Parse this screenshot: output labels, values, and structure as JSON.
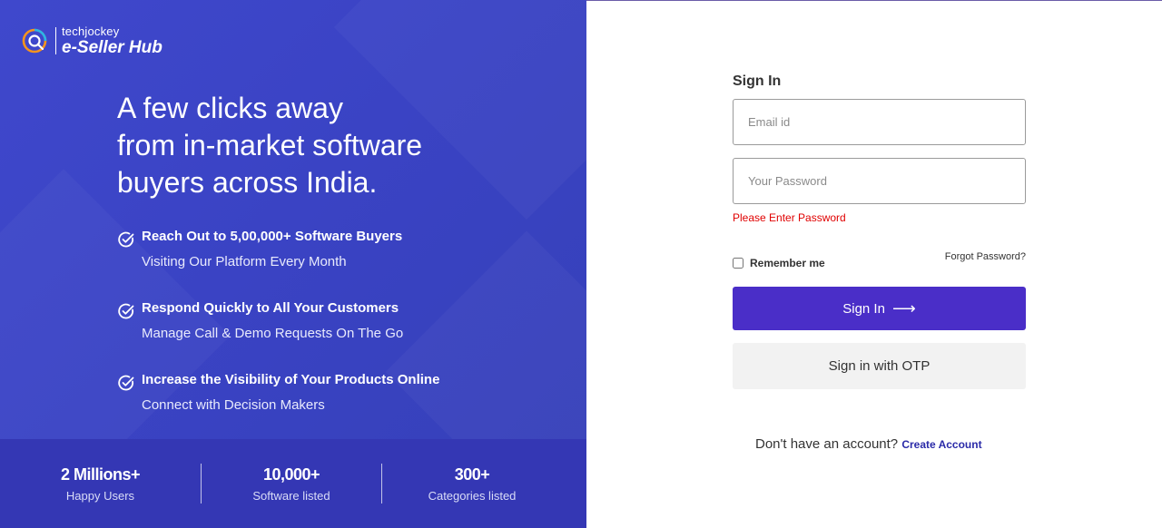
{
  "brand": {
    "small": "techjockey",
    "big": "e-Seller Hub",
    "accent_colors": [
      "#f7941d",
      "#29b5e8"
    ]
  },
  "hero": {
    "headline_lines": [
      "A few clicks away",
      "from in-market software",
      "buyers across India."
    ]
  },
  "features": [
    {
      "icon": "check-circle-icon",
      "title": "Reach Out to 5,00,000+ Software Buyers",
      "subtitle": "Visiting Our Platform Every Month"
    },
    {
      "icon": "check-circle-icon",
      "title": "Respond Quickly to All Your Customers",
      "subtitle": "Manage Call & Demo Requests On The Go"
    },
    {
      "icon": "check-circle-icon",
      "title": "Increase the Visibility of Your Products Online",
      "subtitle": "Connect with Decision Makers"
    }
  ],
  "stats": [
    {
      "value": "2 Millions+",
      "label": "Happy Users"
    },
    {
      "value": "10,000+",
      "label": "Software listed"
    },
    {
      "value": "300+",
      "label": "Categories listed"
    }
  ],
  "signin": {
    "title": "Sign In",
    "email_placeholder": "Email id",
    "email_value": "",
    "password_placeholder": "Your Password",
    "password_value": "",
    "password_error": "Please Enter Password",
    "remember_label": "Remember me",
    "remember_checked": false,
    "forgot_label": "Forgot Password?",
    "submit_label": "Sign In",
    "submit_arrow": "⟶",
    "otp_label": "Sign in with OTP",
    "no_account_text": "Don't have an account?",
    "create_account_label": "Create Account"
  },
  "colors": {
    "panel_bg": "#3f48cc",
    "stats_bg": "#3437b4",
    "primary_button": "#4a2ec8",
    "error": "#e00000",
    "link": "#2a2aa8"
  }
}
